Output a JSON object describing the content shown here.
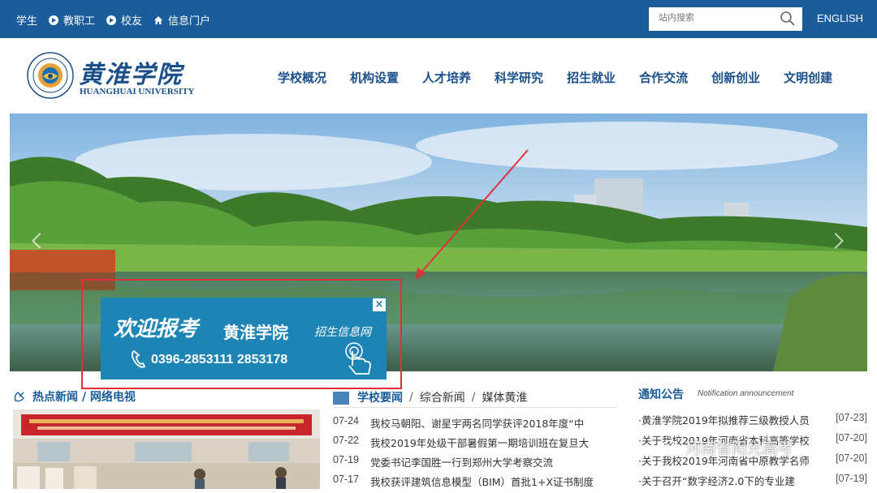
{
  "topbar": {
    "links": [
      {
        "label": "学生"
      },
      {
        "label": "教职工"
      },
      {
        "label": "校友"
      },
      {
        "label": "信息门户"
      }
    ],
    "search_placeholder": "站内搜索",
    "english_label": "ENGLISH"
  },
  "header": {
    "logo_cn": "黄淮学院",
    "logo_en": "HUANGHUAI UNIVERSITY",
    "nav": [
      "学校概况",
      "机构设置",
      "人才培养",
      "科学研究",
      "招生就业",
      "合作交流",
      "创新创业",
      "文明创建"
    ]
  },
  "ad": {
    "title1": "欢迎报考",
    "title2": "黄淮学院",
    "subtitle": "招生信息网",
    "phone": "0396-2853111  2853178",
    "close": "×"
  },
  "hot": {
    "title": "热点新闻 / 网络电视"
  },
  "news": {
    "tabs": [
      "学校要闻",
      "综合新闻",
      "媒体黄淮"
    ],
    "items": [
      {
        "date": "07-24",
        "text": "我校马朝阳、谢星宇两名同学获评2018年度“中"
      },
      {
        "date": "07-22",
        "text": "我校2019年处级干部暑假第一期培训班在复旦大"
      },
      {
        "date": "07-19",
        "text": "党委书记李国胜一行到郑州大学考察交流"
      },
      {
        "date": "07-17",
        "text": "我校获评建筑信息模型（BIM）首批1+X证书制度"
      }
    ]
  },
  "notice": {
    "title": "通知公告",
    "subtitle": "Notification announcement",
    "items": [
      {
        "text": "·黄淮学院2019年拟推荐三级教授人员",
        "date": "[07-23]"
      },
      {
        "text": "·关于我校2019年河南省本科高等学校",
        "date": "[07-20]"
      },
      {
        "text": "·关于我校2019年河南省中原教学名师",
        "date": "[07-20]"
      },
      {
        "text": "·关于召开“数字经济2.0下的专业建",
        "date": "[07-19]"
      }
    ]
  },
  "watermark": {
    "text": "河南省阳光高考"
  },
  "colors": {
    "brand_blue": "#1a5d9a",
    "ad_blue": "#1e84b5",
    "annotation_red": "#e0303a"
  }
}
